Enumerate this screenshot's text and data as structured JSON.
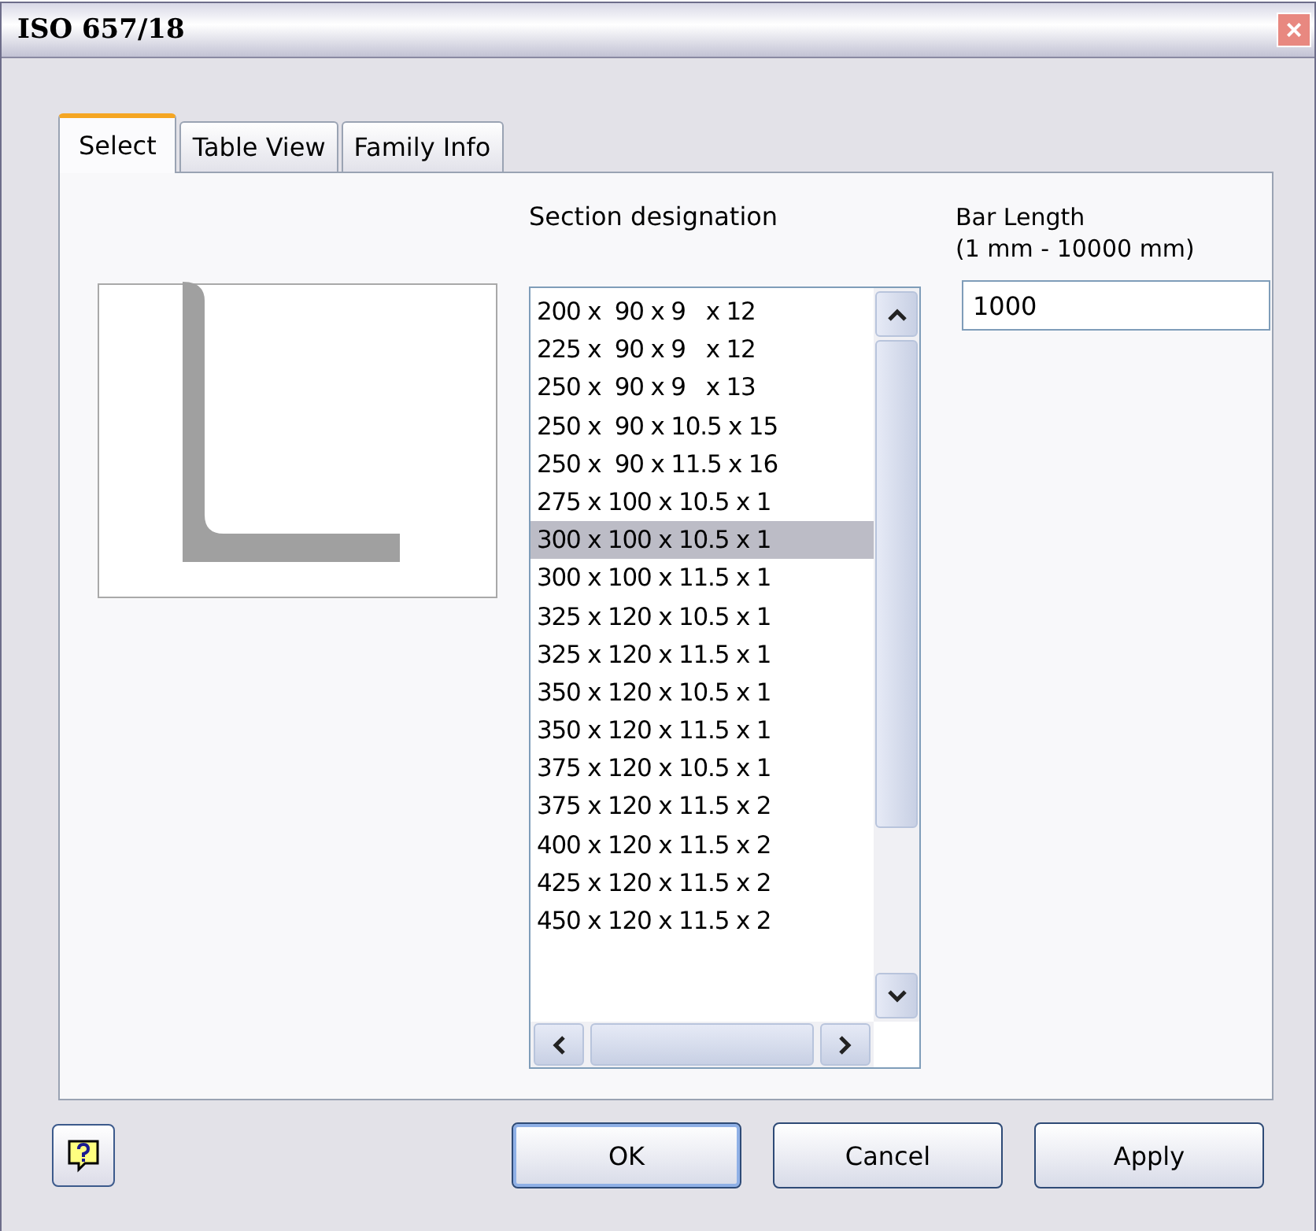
{
  "window": {
    "title": "ISO 657/18",
    "close": "×"
  },
  "tabs": [
    {
      "label": "Select",
      "selected": true
    },
    {
      "label": "Table View",
      "selected": false
    },
    {
      "label": "Family Info",
      "selected": false
    }
  ],
  "section_designation": {
    "label": "Section designation",
    "items": [
      {
        "text": "200 x  90 x 9   x 12",
        "selected": false
      },
      {
        "text": "225 x  90 x 9   x 12",
        "selected": false
      },
      {
        "text": "250 x  90 x 9   x 13",
        "selected": false
      },
      {
        "text": "250 x  90 x 10.5 x 15",
        "selected": false
      },
      {
        "text": "250 x  90 x 11.5 x 16",
        "selected": false
      },
      {
        "text": "275 x 100 x 10.5 x 1",
        "selected": false
      },
      {
        "text": "300 x 100 x 10.5 x 1",
        "selected": true
      },
      {
        "text": "300 x 100 x 11.5 x 1",
        "selected": false
      },
      {
        "text": "325 x 120 x 10.5 x 1",
        "selected": false
      },
      {
        "text": "325 x 120 x 11.5 x 1",
        "selected": false
      },
      {
        "text": "350 x 120 x 10.5 x 1",
        "selected": false
      },
      {
        "text": "350 x 120 x 11.5 x 1",
        "selected": false
      },
      {
        "text": "375 x 120 x 10.5 x 1",
        "selected": false
      },
      {
        "text": "375 x 120 x 11.5 x 2",
        "selected": false
      },
      {
        "text": "400 x 120 x 11.5 x 2",
        "selected": false
      },
      {
        "text": "425 x 120 x 11.5 x 2",
        "selected": false
      },
      {
        "text": "450 x 120 x 11.5 x 2",
        "selected": false
      }
    ]
  },
  "bar_length": {
    "label": "Bar Length",
    "range": "(1 mm - 10000 mm)",
    "value": "1000"
  },
  "buttons": [
    {
      "label": "OK",
      "default": true
    },
    {
      "label": "Cancel",
      "default": false
    },
    {
      "label": "Apply",
      "default": false
    }
  ]
}
